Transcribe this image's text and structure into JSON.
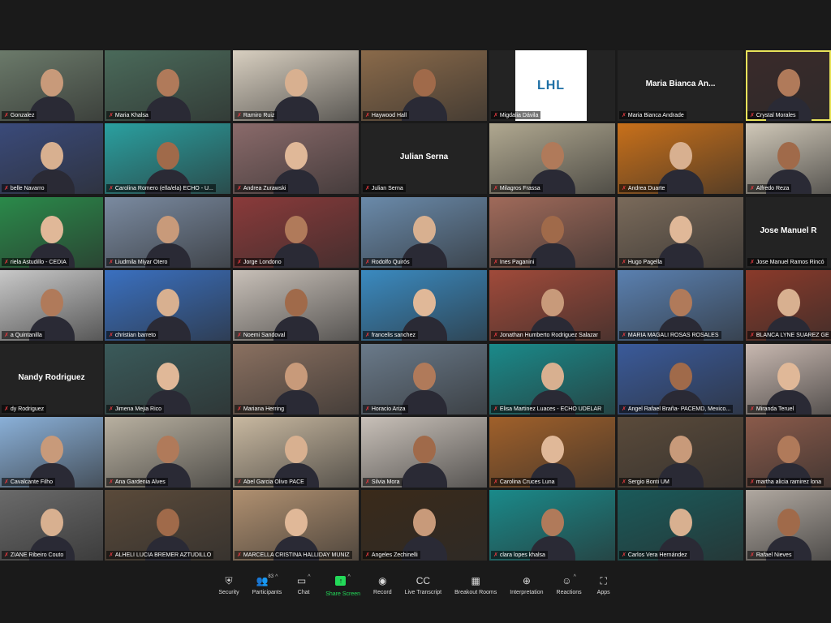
{
  "colors": {
    "mute": "#e0393e",
    "active_border": "#e8e35a",
    "share_green": "#23d959"
  },
  "tiles": [
    {
      "name": "Gonzalez",
      "bg": "#6b7a6a"
    },
    {
      "name": "Maria Khalsa",
      "bg": "#4a6a5a"
    },
    {
      "name": "Ramiro Ruiz",
      "bg": "#d8cfc0"
    },
    {
      "name": "Haywood Hall",
      "bg": "#8a6a4a"
    },
    {
      "name": "Migdalia Dávila",
      "bg": "#232323",
      "logo": "LHL"
    },
    {
      "name": "Maria Bianca Andrade",
      "bg": "#232323",
      "big": "Maria Bianca An..."
    },
    {
      "name": "Crystal Morales",
      "bg": "#3a2a2a",
      "active": true
    },
    {
      "name": "belle Navarro",
      "bg": "#3a4a7a"
    },
    {
      "name": "Carolina Romero (ella/ela) ECHO - U...",
      "bg": "#2aa0a0"
    },
    {
      "name": "Andrea Zurawski",
      "bg": "#8a6a6a"
    },
    {
      "name": "Julian Serna",
      "bg": "#232323",
      "big": "Julian Serna"
    },
    {
      "name": "Milagros Frassa",
      "bg": "#b0a890"
    },
    {
      "name": "Andrea Duarte",
      "bg": "#c8701a"
    },
    {
      "name": "Alfredo Reza",
      "bg": "#d0c8b8"
    },
    {
      "name": "riela Astudillo - CEDIA",
      "bg": "#2a8a4a"
    },
    {
      "name": "Liudmila Miyar Otero",
      "bg": "#7a8aa0"
    },
    {
      "name": "Jorge Londono",
      "bg": "#8a3a3a"
    },
    {
      "name": "Rodolfo Quirós",
      "bg": "#6a8aaa"
    },
    {
      "name": "Ines Paganini",
      "bg": "#a06a5a"
    },
    {
      "name": "Hugo Pagella",
      "bg": "#7a6a5a"
    },
    {
      "name": "Jose Manuel Ramos Rincó",
      "bg": "#232323",
      "big": "Jose Manuel R"
    },
    {
      "name": "a Quintanilla",
      "bg": "#c8c8c8"
    },
    {
      "name": "christian barreto",
      "bg": "#3a70c0"
    },
    {
      "name": "Noemi Sandoval",
      "bg": "#c8c0b8"
    },
    {
      "name": "francelis sanchez",
      "bg": "#3a8ac0"
    },
    {
      "name": "Jonathan Humberto Rodriguez Salazar",
      "bg": "#a04a3a"
    },
    {
      "name": "MARIA MAGALI ROSAS ROSALES",
      "bg": "#5a80b0"
    },
    {
      "name": "BLANCA LYNE SUAREZ GE",
      "bg": "#8a3a2a"
    },
    {
      "name": "dy Rodriguez",
      "bg": "#232323",
      "big": "Nandy Rodriguez"
    },
    {
      "name": "Jimena Mejia Rico",
      "bg": "#3a5a5a"
    },
    {
      "name": "Mariana Herring",
      "bg": "#8a7060"
    },
    {
      "name": "Horacio Ariza",
      "bg": "#6a7a8a"
    },
    {
      "name": "Elisa Martinez Luaces - ECHO UDELAR",
      "bg": "#1a8a8a"
    },
    {
      "name": "Angel Rafael Braña- PACEMD, Mexico...",
      "bg": "#3a5a9a"
    },
    {
      "name": "Miranda Teruel",
      "bg": "#c8b8b0"
    },
    {
      "name": "Cavalcante Filho",
      "bg": "#8ab0d8"
    },
    {
      "name": "Ana Gardenia Alves",
      "bg": "#b8b0a0"
    },
    {
      "name": "Abel Garcia Olivo PACE",
      "bg": "#c8b8a0"
    },
    {
      "name": "Silvia Mora",
      "bg": "#c8c0b8"
    },
    {
      "name": "Carolina Cruces Luna",
      "bg": "#a0602a"
    },
    {
      "name": "Sergio Bonti UM",
      "bg": "#5a4a3a"
    },
    {
      "name": "martha alicia ramirez lona",
      "bg": "#8a5a4a"
    },
    {
      "name": "ZIANE Ribeiro Couto",
      "bg": "#6a6a6a"
    },
    {
      "name": "ALHELI LUCIA BREMER AZTUDILLO",
      "bg": "#5a4a3a"
    },
    {
      "name": "MARCELLA CRISTINA HALLIDAY MUNIZ",
      "bg": "#b09070"
    },
    {
      "name": "Angeles Zechinelli",
      "bg": "#3a2a1a"
    },
    {
      "name": "clara lopes khalsa",
      "bg": "#1a8a8a"
    },
    {
      "name": "Carlos Vera Hernández",
      "bg": "#1a5a5a"
    },
    {
      "name": "Rafael Nieves",
      "bg": "#b0a8a0"
    }
  ],
  "toolbar": [
    {
      "label": "Security",
      "icon": "shield-icon",
      "glyph": "⛨"
    },
    {
      "label": "Participants",
      "icon": "participants-icon",
      "glyph": "👥",
      "count": "83",
      "caret": true
    },
    {
      "label": "Chat",
      "icon": "chat-icon",
      "glyph": "▭",
      "caret": true
    },
    {
      "label": "Share Screen",
      "icon": "share-screen-icon",
      "glyph": "↑",
      "caret": true,
      "share": true
    },
    {
      "label": "Record",
      "icon": "record-icon",
      "glyph": "◉"
    },
    {
      "label": "Live Transcript",
      "icon": "cc-icon",
      "glyph": "CC"
    },
    {
      "label": "Breakout Rooms",
      "icon": "breakout-rooms-icon",
      "glyph": "▦"
    },
    {
      "label": "Interpretation",
      "icon": "globe-icon",
      "glyph": "⊕"
    },
    {
      "label": "Reactions",
      "icon": "reactions-icon",
      "glyph": "☺",
      "caret": true
    },
    {
      "label": "Apps",
      "icon": "apps-icon",
      "glyph": "⛶"
    }
  ]
}
